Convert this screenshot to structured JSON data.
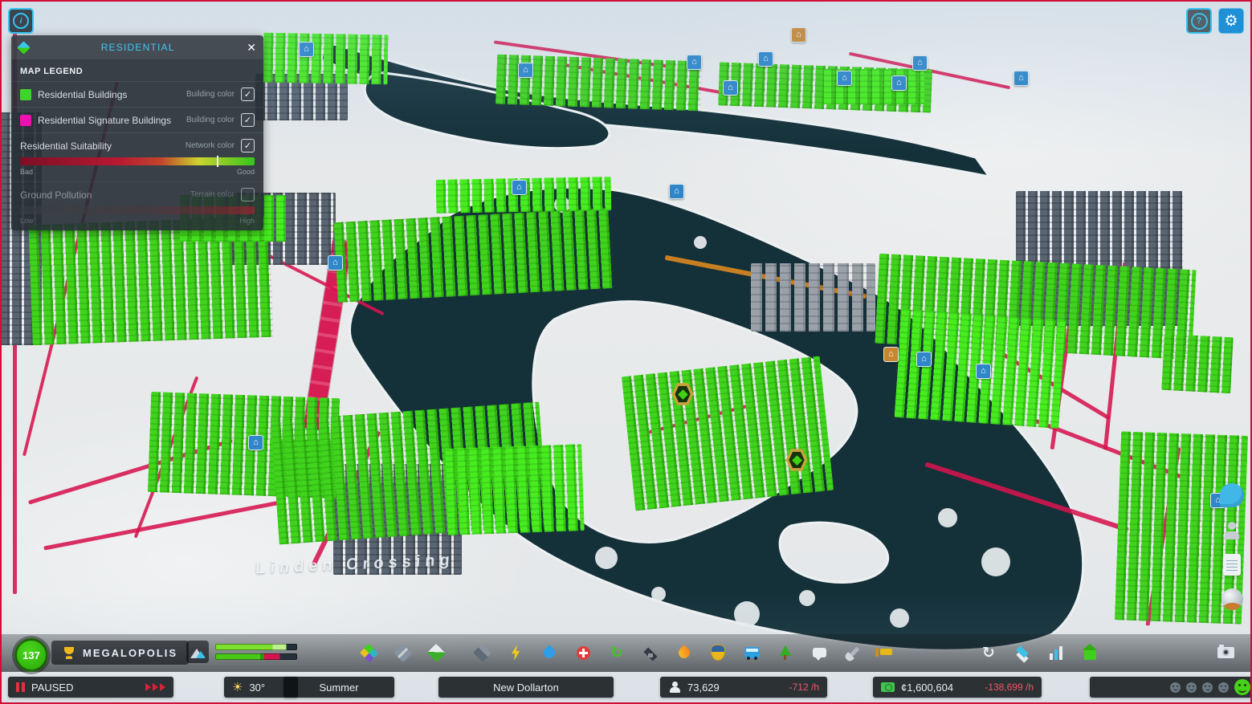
{
  "colors": {
    "accent_cyan": "#41c8f4",
    "residential_green": "#3fd42c",
    "signature_magenta": "#ee10b0",
    "suitability_bad": "#7d0f24",
    "suitability_good": "#35c51c",
    "road_red": "#d6134d",
    "water": "#143039",
    "trend_negative": "#f0566a"
  },
  "glyphs": {
    "info": "i",
    "help": "?",
    "settings": "⚙",
    "close": "✕",
    "recycle": "↻",
    "progression": "↻",
    "house": "⌂",
    "sun": "☀"
  },
  "legend": {
    "title": "RESIDENTIAL",
    "section_title": "MAP LEGEND",
    "rows": [
      {
        "label": "Residential Buildings",
        "channel": "Building color",
        "checked": true
      },
      {
        "label": "Residential Signature Buildings",
        "channel": "Building color",
        "checked": true
      },
      {
        "label": "Residential Suitability",
        "channel": "Network color",
        "checked": true,
        "min_label": "Bad",
        "max_label": "Good"
      },
      {
        "label": "Ground Pollution",
        "channel": "Terrain color",
        "checked": false,
        "min_label": "Low",
        "max_label": "High"
      }
    ]
  },
  "map": {
    "place_label": "Linden Crossing"
  },
  "toolbar": {
    "level": "137",
    "milestone": "MEGALOPOLIS",
    "tools": [
      "zoning",
      "roads",
      "landscaping",
      "terrain",
      "electricity",
      "water-sewage",
      "healthcare",
      "garbage",
      "education",
      "fire-rescue",
      "police",
      "transportation",
      "parks-recreation",
      "communications",
      "city-services",
      "bulldozer"
    ],
    "right_tools": [
      "progression",
      "info-views",
      "statistics",
      "advisor"
    ],
    "camera": "photo-mode"
  },
  "side_tools": [
    "chirper",
    "followed-citizen",
    "journal",
    "globe"
  ],
  "status_bar": {
    "pause_label": "PAUSED",
    "temperature": "30°",
    "season": "Summer",
    "city_name": "New Dollarton",
    "population": "73,629",
    "population_trend": "-712 /h",
    "money": "¢1,600,604",
    "money_trend": "-138,699 /h"
  }
}
